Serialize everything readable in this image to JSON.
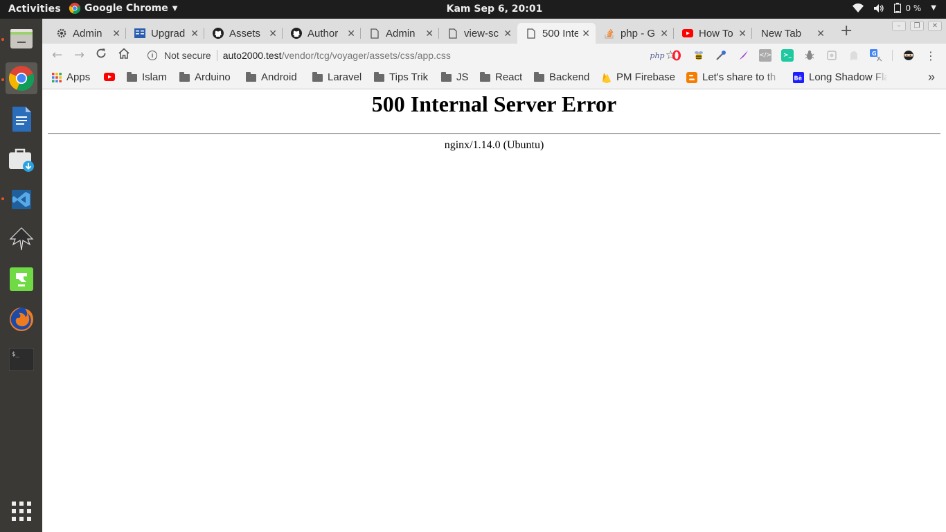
{
  "topbar": {
    "activities": "Activities",
    "app_name": "Google Chrome",
    "clock": "Kam Sep  6, 20:01",
    "battery_percent": "0 %"
  },
  "dock": {
    "items": [
      {
        "name": "files-app",
        "running": true
      },
      {
        "name": "google-chrome",
        "running": true,
        "active": true
      },
      {
        "name": "libreoffice-writer"
      },
      {
        "name": "software-updater"
      },
      {
        "name": "vscode",
        "running": true
      },
      {
        "name": "inkscape"
      },
      {
        "name": "upwork"
      },
      {
        "name": "firefox"
      },
      {
        "name": "terminal"
      }
    ],
    "show_apps": "grid-icon"
  },
  "tabs": [
    {
      "label": "Admin",
      "icon": "gear-icon"
    },
    {
      "label": "Upgrad",
      "icon": "book-icon"
    },
    {
      "label": "Assets",
      "icon": "github-icon"
    },
    {
      "label": "Author",
      "icon": "github-icon"
    },
    {
      "label": "Admin",
      "icon": "page-icon"
    },
    {
      "label": "view-sc",
      "icon": "page-icon"
    },
    {
      "label": "500 Inte",
      "icon": "page-icon",
      "active": true
    },
    {
      "label": "php - G",
      "icon": "stackoverflow-icon"
    },
    {
      "label": "How To",
      "icon": "youtube-icon"
    },
    {
      "label": "New Tab",
      "icon": ""
    }
  ],
  "omnibox": {
    "security_label": "Not secure",
    "host": "auto2000.test",
    "path": "/vendor/tcg/voyager/assets/css/app.css"
  },
  "extensions": [
    "php",
    "opera",
    "bee",
    "eyedropper",
    "feather",
    "code",
    "terminal",
    "bug",
    "puzzle",
    "ghost",
    "translate",
    "ninja"
  ],
  "bookmarks": [
    {
      "label": "Apps",
      "icon": "apps-grid-icon"
    },
    {
      "label": "",
      "icon": "youtube-icon"
    },
    {
      "label": "Islam",
      "icon": "folder-icon"
    },
    {
      "label": "Arduino",
      "icon": "folder-icon"
    },
    {
      "label": "Android",
      "icon": "folder-icon"
    },
    {
      "label": "Laravel",
      "icon": "folder-icon"
    },
    {
      "label": "Tips Trik",
      "icon": "folder-icon"
    },
    {
      "label": "JS",
      "icon": "folder-icon"
    },
    {
      "label": "React",
      "icon": "folder-icon"
    },
    {
      "label": "Backend",
      "icon": "folder-icon"
    },
    {
      "label": "PM Firebase",
      "icon": "firebase-icon"
    },
    {
      "label": "Let's share to th",
      "icon": "blogger-icon"
    },
    {
      "label": "Long Shadow Fla",
      "icon": "behance-icon"
    }
  ],
  "page": {
    "heading": "500 Internal Server Error",
    "server": "nginx/1.14.0 (Ubuntu)"
  },
  "colors": {
    "ubuntu_orange": "#e95420",
    "topbar_bg": "#1d1d1d",
    "dock_bg": "#3b3935",
    "tabstrip_bg": "#dedede",
    "toolbar_bg": "#f3f3f3"
  }
}
